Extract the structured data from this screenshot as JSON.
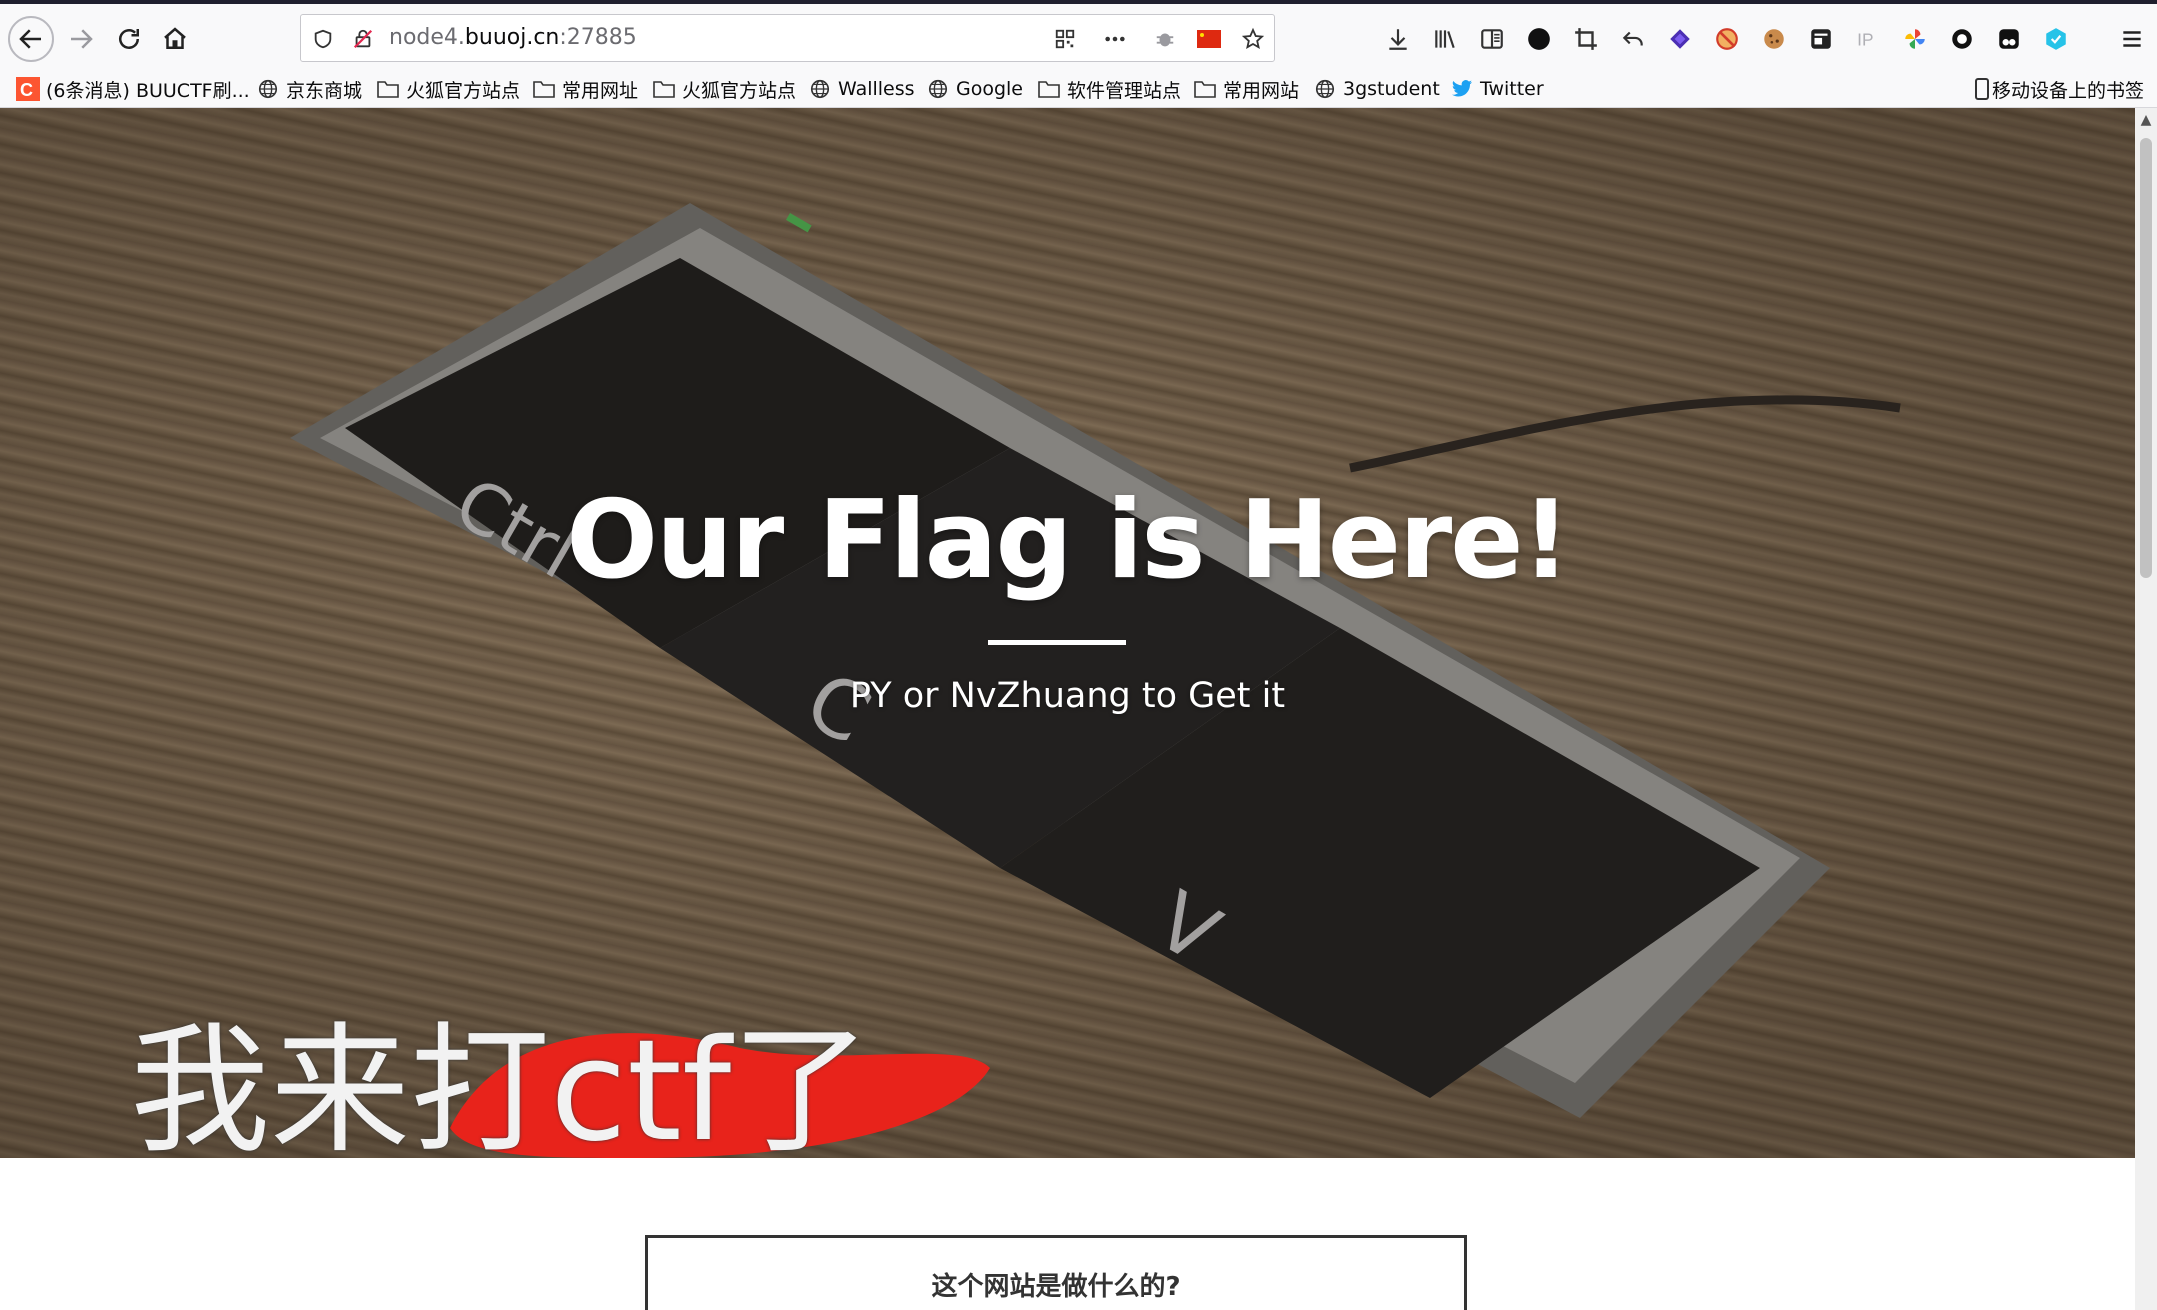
{
  "browser": {
    "url_prefix": "node4.",
    "url_host": "buuoj.cn",
    "url_suffix": ":27885"
  },
  "bookmarks": [
    {
      "label": "(6条消息) BUUCTF刷...",
      "icon": "csdn-icon"
    },
    {
      "label": "京东商城",
      "icon": "globe-icon"
    },
    {
      "label": "火狐官方站点",
      "icon": "folder-icon"
    },
    {
      "label": "常用网址",
      "icon": "folder-icon"
    },
    {
      "label": "火狐官方站点",
      "icon": "folder-icon"
    },
    {
      "label": "Wallless",
      "icon": "globe-icon"
    },
    {
      "label": "Google",
      "icon": "globe-icon"
    },
    {
      "label": "软件管理站点",
      "icon": "folder-icon"
    },
    {
      "label": "常用网站",
      "icon": "folder-icon"
    },
    {
      "label": "3gstudent",
      "icon": "globe-icon"
    },
    {
      "label": "Twitter",
      "icon": "twitter-icon"
    }
  ],
  "mobile_bookmarks": "移动设备上的书签",
  "hero": {
    "title": "Our Flag is Here!",
    "subtitle": "PY or NvZhuang to Get it",
    "caption": "我来打ctf了"
  },
  "about": {
    "heading": "这个网站是做什么的?"
  },
  "colors": {
    "accent_red": "#e8231b",
    "twitter_blue": "#1da1f2",
    "csdn_red": "#fc5531"
  }
}
